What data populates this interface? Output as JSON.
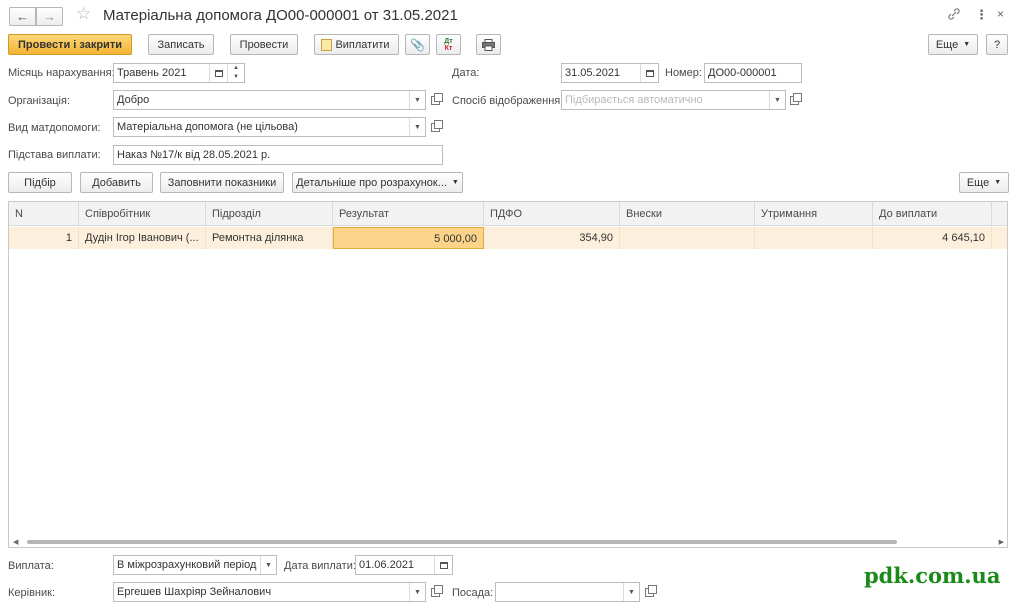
{
  "window": {
    "title": "Матеріальна допомога ДО00-000001 от 31.05.2021"
  },
  "toolbar": {
    "post_close": "Провести і закрити",
    "save": "Записать",
    "post": "Провести",
    "pay": "Виплатити",
    "more": "Еще",
    "help": "?"
  },
  "form": {
    "month_label": "Місяць нарахування:",
    "month_value": "Травень 2021",
    "date_label": "Дата:",
    "date_value": "31.05.2021",
    "number_label": "Номер:",
    "number_value": "ДО00-000001",
    "org_label": "Організація:",
    "org_value": "Добро",
    "display_label": "Спосіб відображення:",
    "display_placeholder": "Підбирається автоматично",
    "aid_type_label": "Вид матдопомоги:",
    "aid_type_value": "Матеріальна допомога (не цільова)",
    "basis_label": "Підстава виплати:",
    "basis_value": "Наказ №17/к від 28.05.2021 р."
  },
  "table_toolbar": {
    "select": "Підбір",
    "add": "Добавить",
    "fill": "Заповнити показники",
    "details": "Детальніше про розрахунок...",
    "more": "Еще"
  },
  "table": {
    "columns": [
      "N",
      "Співробітник",
      "Підрозділ",
      "Результат",
      "ПДФО",
      "Внески",
      "Утримання",
      "До виплати"
    ],
    "rows": [
      {
        "n": "1",
        "employee": "Дудін Ігор Іванович (...",
        "department": "Ремонтна ділянка",
        "result": "5 000,00",
        "pdfo": "354,90",
        "contrib": "",
        "deductions": "",
        "to_pay": "4 645,10"
      }
    ]
  },
  "footer": {
    "payment_label": "Виплата:",
    "payment_value": "В міжрозрахунковий період",
    "pay_date_label": "Дата виплати:",
    "pay_date_value": "01.06.2021",
    "head_label": "Керівник:",
    "head_value": "Ергешев Шахріяр Зейналович",
    "position_label": "Посада:",
    "position_value": ""
  },
  "watermark": "pdk.com.ua"
}
